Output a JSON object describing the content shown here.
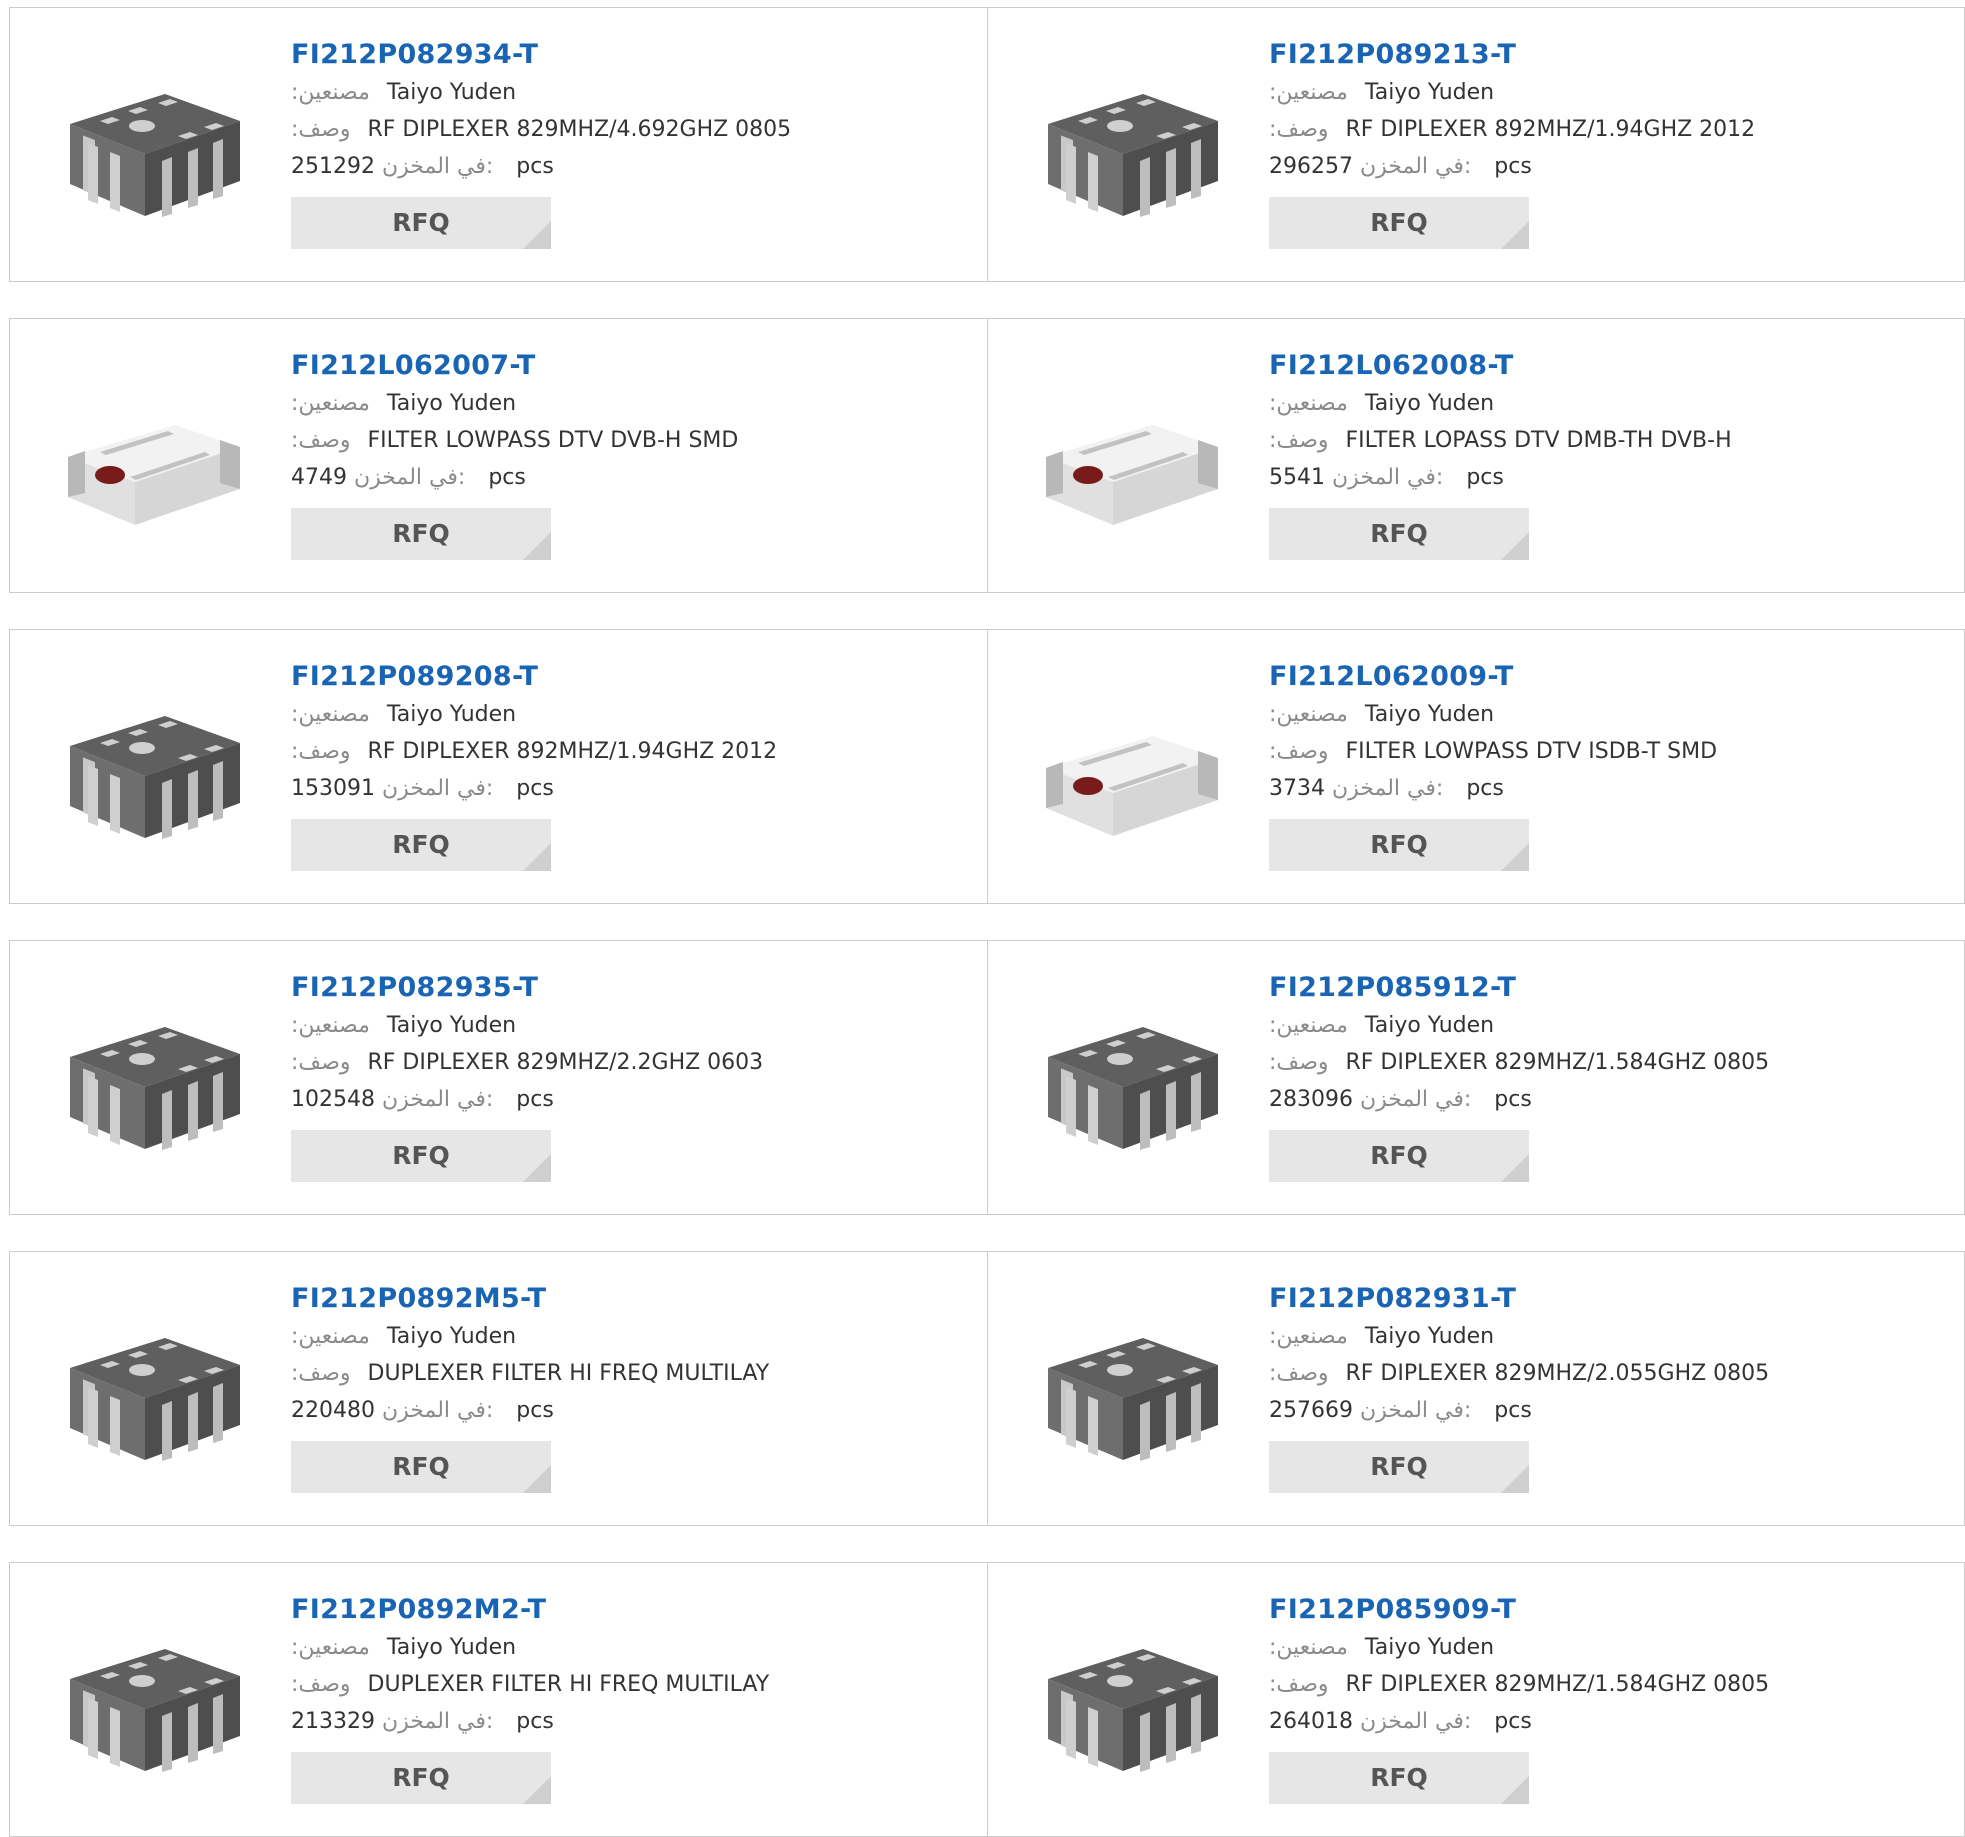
{
  "labels": {
    "manufacturer": ":مصنعين",
    "description": ":وصف",
    "stock": "في المخزن:",
    "unit": "pcs",
    "rfq": "RFQ"
  },
  "colors": {
    "part_link": "#1a64b4",
    "button_bg": "#e6e6e6",
    "button_corner": "#cfcfcf"
  },
  "products": [
    {
      "pn": "FI212P082934-T",
      "mfr": "Taiyo Yuden",
      "desc": "RF DIPLEXER 829MHZ/4.692GHZ 0805",
      "stock": "251292",
      "image": "dark-chip-icon"
    },
    {
      "pn": "FI212P089213-T",
      "mfr": "Taiyo Yuden",
      "desc": "RF DIPLEXER 892MHZ/1.94GHZ 2012",
      "stock": "296257",
      "image": "dark-chip-icon"
    },
    {
      "pn": "FI212L062007-T",
      "mfr": "Taiyo Yuden",
      "desc": "FILTER LOWPASS DTV DVB-H SMD",
      "stock": "4749",
      "image": "white-chip-icon"
    },
    {
      "pn": "FI212L062008-T",
      "mfr": "Taiyo Yuden",
      "desc": "FILTER LOPASS DTV DMB-TH DVB-H",
      "stock": "5541",
      "image": "white-chip-icon"
    },
    {
      "pn": "FI212P089208-T",
      "mfr": "Taiyo Yuden",
      "desc": "RF DIPLEXER 892MHZ/1.94GHZ 2012",
      "stock": "153091",
      "image": "dark-chip-icon"
    },
    {
      "pn": "FI212L062009-T",
      "mfr": "Taiyo Yuden",
      "desc": "FILTER LOWPASS DTV ISDB-T SMD",
      "stock": "3734",
      "image": "white-chip-icon"
    },
    {
      "pn": "FI212P082935-T",
      "mfr": "Taiyo Yuden",
      "desc": "RF DIPLEXER 829MHZ/2.2GHZ 0603",
      "stock": "102548",
      "image": "dark-chip-icon"
    },
    {
      "pn": "FI212P085912-T",
      "mfr": "Taiyo Yuden",
      "desc": "RF DIPLEXER 829MHZ/1.584GHZ 0805",
      "stock": "283096",
      "image": "dark-chip-icon"
    },
    {
      "pn": "FI212P0892M5-T",
      "mfr": "Taiyo Yuden",
      "desc": "DUPLEXER FILTER HI FREQ MULTILAY",
      "stock": "220480",
      "image": "dark-chip-icon"
    },
    {
      "pn": "FI212P082931-T",
      "mfr": "Taiyo Yuden",
      "desc": "RF DIPLEXER 829MHZ/2.055GHZ 0805",
      "stock": "257669",
      "image": "dark-chip-icon"
    },
    {
      "pn": "FI212P0892M2-T",
      "mfr": "Taiyo Yuden",
      "desc": "DUPLEXER FILTER HI FREQ MULTILAY",
      "stock": "213329",
      "image": "dark-chip-icon"
    },
    {
      "pn": "FI212P085909-T",
      "mfr": "Taiyo Yuden",
      "desc": "RF DIPLEXER 829MHZ/1.584GHZ 0805",
      "stock": "264018",
      "image": "dark-chip-icon"
    }
  ]
}
